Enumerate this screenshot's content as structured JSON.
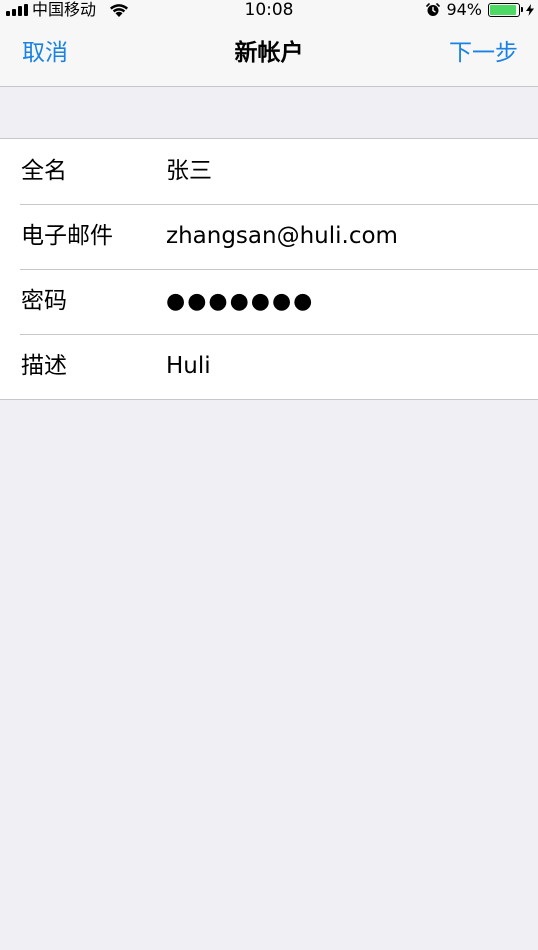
{
  "status_bar": {
    "carrier": "中国移动",
    "time": "10:08",
    "battery_percent": "94%",
    "battery_level": 0.94,
    "icons": [
      "signal-icon",
      "wifi-icon",
      "alarm-icon",
      "battery-icon",
      "charging-bolt-icon"
    ]
  },
  "nav": {
    "cancel_label": "取消",
    "title": "新帐户",
    "next_label": "下一步",
    "accent_color": "#1a82e2"
  },
  "form": {
    "rows": [
      {
        "label": "全名",
        "value": "张三"
      },
      {
        "label": "电子邮件",
        "value": "zhangsan@huli.com"
      },
      {
        "label": "密码",
        "value": "●●●●●●●"
      },
      {
        "label": "描述",
        "value": "Huli"
      }
    ]
  }
}
